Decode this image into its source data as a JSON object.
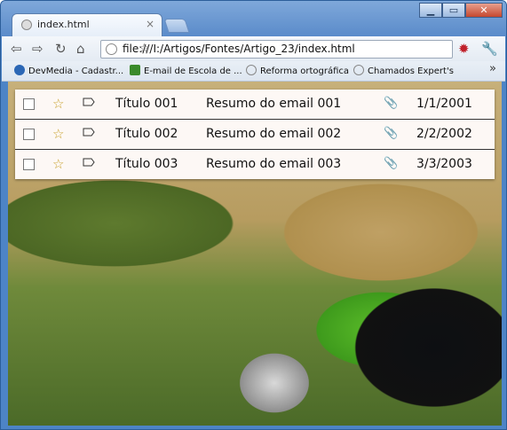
{
  "browser": {
    "tab_title": "index.html",
    "tab_close": "×",
    "url": "file:///I:/Artigos/Fontes/Artigo_23/index.html",
    "bookmarks": [
      {
        "label": "DevMedia - Cadastr...",
        "color": "#2b67b5"
      },
      {
        "label": "E-mail de Escola de ...",
        "color": "#3a8a2b"
      },
      {
        "label": "Reforma ortográfica",
        "color": "#888888"
      },
      {
        "label": "Chamados Expert's",
        "color": "#888888"
      }
    ],
    "more": "»"
  },
  "emails": [
    {
      "title": "Título 001",
      "summary": "Resumo do email 001",
      "date": "1/1/2001"
    },
    {
      "title": "Título 002",
      "summary": "Resumo do email 002",
      "date": "2/2/2002"
    },
    {
      "title": "Título 003",
      "summary": "Resumo do email 003",
      "date": "3/3/2003"
    }
  ]
}
